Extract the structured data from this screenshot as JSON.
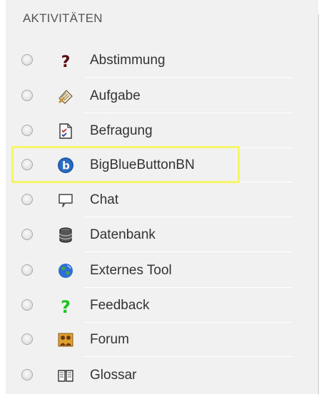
{
  "section": {
    "header": "AKTIVITÄTEN"
  },
  "activities": [
    {
      "label": "Abstimmung",
      "icon": "question-icon"
    },
    {
      "label": "Aufgabe",
      "icon": "assignment-icon"
    },
    {
      "label": "Befragung",
      "icon": "survey-icon"
    },
    {
      "label": "BigBlueButtonBN",
      "icon": "bigbluebutton-icon",
      "highlighted": true
    },
    {
      "label": "Chat",
      "icon": "chat-icon"
    },
    {
      "label": "Datenbank",
      "icon": "database-icon"
    },
    {
      "label": "Externes Tool",
      "icon": "external-tool-icon"
    },
    {
      "label": "Feedback",
      "icon": "feedback-icon"
    },
    {
      "label": "Forum",
      "icon": "forum-icon"
    },
    {
      "label": "Glossar",
      "icon": "glossary-icon"
    }
  ],
  "colors": {
    "highlight": "#f5f56a",
    "panel_bg": "#f1f1f1"
  }
}
